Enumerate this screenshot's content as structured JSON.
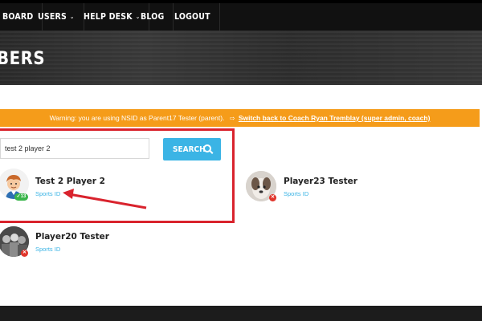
{
  "nav": {
    "items": [
      {
        "label": "BOARD",
        "has_dropdown": false
      },
      {
        "label": "USERS",
        "has_dropdown": true
      },
      {
        "label": "HELP DESK",
        "has_dropdown": true
      },
      {
        "label": "BLOG",
        "has_dropdown": false
      },
      {
        "label": "LOGOUT",
        "has_dropdown": false
      }
    ],
    "dropdown_glyph": "⌄"
  },
  "banner": {
    "title": "BERS"
  },
  "warning": {
    "text": "Warning: you are using NSID as Parent17 Tester (parent).",
    "switch_icon": "⇨",
    "switch_label": "Switch back to Coach Ryan Tremblay (super admin, coach)"
  },
  "search": {
    "value": "test 2 player 2",
    "button_label": "SEARCH"
  },
  "results": [
    {
      "name": "Test 2 Player 2",
      "sub": "Sports ID",
      "badge": "✓13",
      "badge_color": "#39b54a"
    },
    {
      "name": "Player23 Tester",
      "sub": "Sports ID",
      "badge": "✕",
      "badge_color": "#e0352b"
    },
    {
      "name": "Player20 Tester",
      "sub": "Sports ID",
      "badge": "✕",
      "badge_color": "#e0352b"
    }
  ],
  "colors": {
    "accent": "#3bb4e5",
    "warning": "#f59c1a",
    "highlight": "#d9232d"
  }
}
